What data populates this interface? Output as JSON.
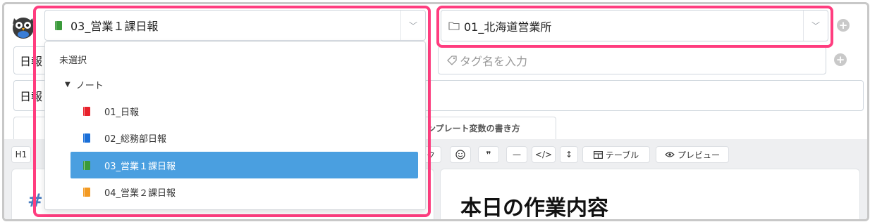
{
  "notebook_select": {
    "value": "03_営業１課日報",
    "icon": "green-notebook-icon",
    "icon_color": "#3a9a3a"
  },
  "folder_select": {
    "value": "01_北海道営業所",
    "icon": "folder-icon"
  },
  "title_field_partial": "日報",
  "second_field_partial": "日報",
  "tag_input": {
    "placeholder": "タグ名を入力",
    "icon": "tag-icon"
  },
  "tabs": {
    "template_vars_partial": "ンプレート変数の書き方"
  },
  "toolbar": {
    "h1_label": "H1",
    "partial_label": "ク",
    "quote_label": "❞",
    "hr_label": "—",
    "code_label": "</>",
    "resize_label": "↕",
    "table_label": "テーブル",
    "preview_label": "プレビュー"
  },
  "editor_left_partial": "#",
  "preview_heading": "本日の作業内容",
  "dropdown": {
    "unselected_label": "未選択",
    "group_label": "ノート",
    "items": [
      {
        "label": "01_日報",
        "color": "#e8222c"
      },
      {
        "label": "02_総務部日報",
        "color": "#1a6fd8"
      },
      {
        "label": "03_営業１課日報",
        "color": "#3a9a3a"
      },
      {
        "label": "04_営業２課日報",
        "color": "#f39a22"
      }
    ]
  },
  "colors": {
    "highlight_border": "#ff3d7f",
    "selected_bg": "#4a9fe0"
  }
}
